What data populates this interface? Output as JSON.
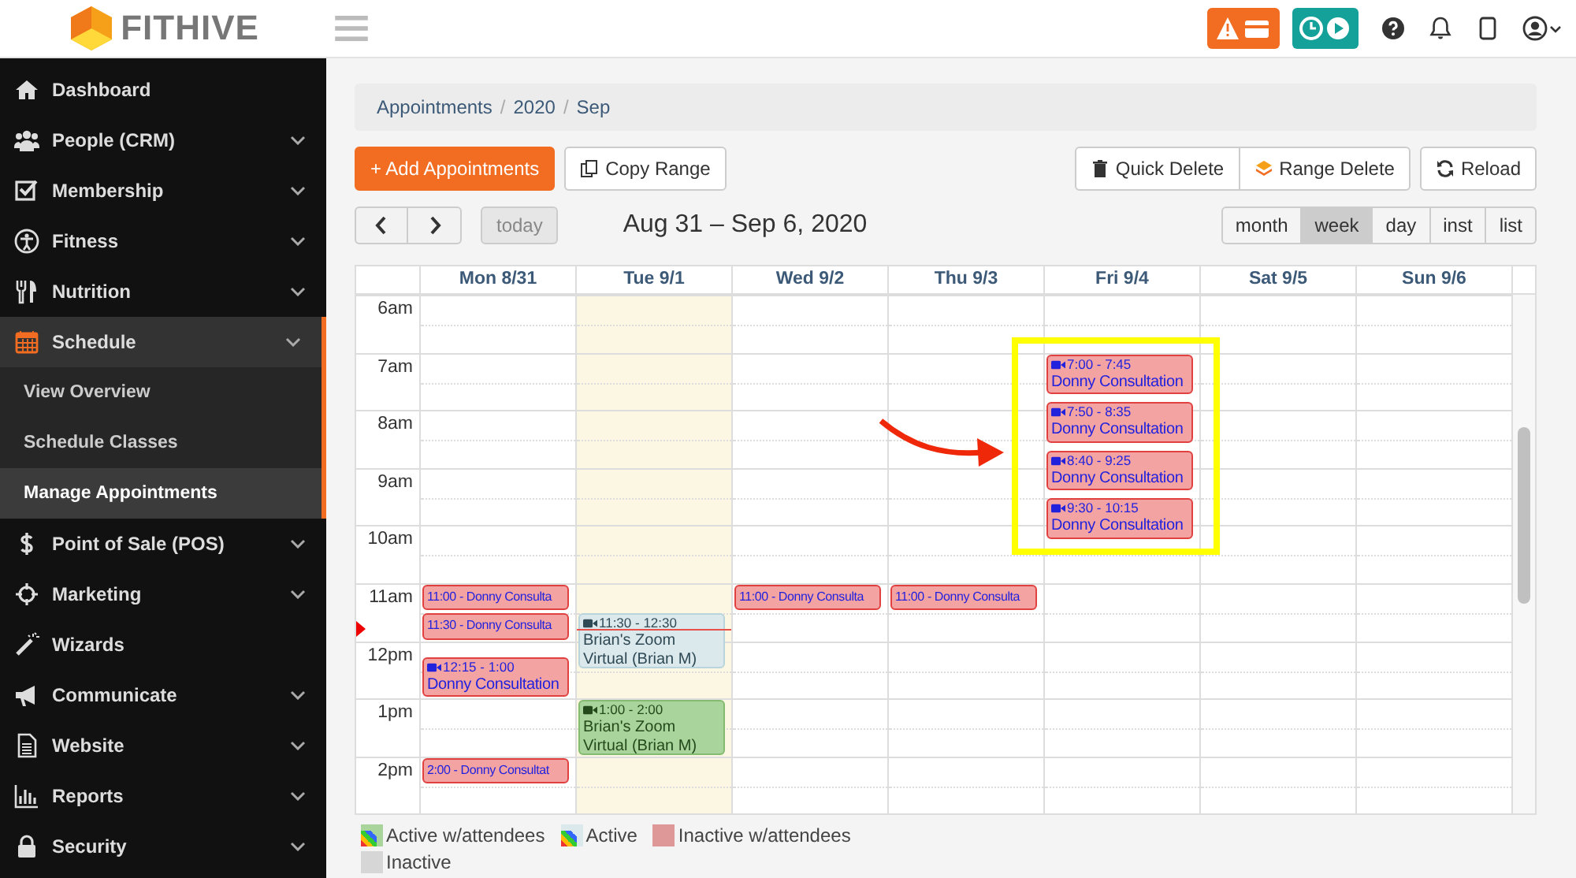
{
  "brand": {
    "name": "FITHIVE"
  },
  "sidebar": {
    "items": [
      {
        "label": "Dashboard",
        "has_submenu": false,
        "selected": false
      },
      {
        "label": "People (CRM)",
        "has_submenu": true,
        "expanded": false,
        "selected": false
      },
      {
        "label": "Membership",
        "has_submenu": true,
        "expanded": false,
        "selected": false
      },
      {
        "label": "Fitness",
        "has_submenu": true,
        "expanded": false,
        "selected": false
      },
      {
        "label": "Nutrition",
        "has_submenu": true,
        "expanded": false,
        "selected": false
      },
      {
        "label": "Schedule",
        "has_submenu": true,
        "expanded": true,
        "selected": true,
        "children": [
          {
            "label": "View Overview",
            "selected": false
          },
          {
            "label": "Schedule Classes",
            "selected": false
          },
          {
            "label": "Manage Appointments",
            "selected": true
          }
        ]
      },
      {
        "label": "Point of Sale (POS)",
        "has_submenu": true,
        "expanded": false,
        "selected": false
      },
      {
        "label": "Marketing",
        "has_submenu": true,
        "expanded": false,
        "selected": false
      },
      {
        "label": "Wizards",
        "has_submenu": false,
        "selected": false
      },
      {
        "label": "Communicate",
        "has_submenu": true,
        "expanded": false,
        "selected": false
      },
      {
        "label": "Website",
        "has_submenu": true,
        "expanded": false,
        "selected": false
      },
      {
        "label": "Reports",
        "has_submenu": true,
        "expanded": false,
        "selected": false
      },
      {
        "label": "Security",
        "has_submenu": true,
        "expanded": false,
        "selected": false
      }
    ]
  },
  "breadcrumb": {
    "items": [
      "Appointments",
      "2020",
      "Sep"
    ],
    "separator": "/"
  },
  "actions": {
    "left": [
      "+ Add Appointments",
      "Copy Range"
    ],
    "right": [
      "Quick Delete",
      "Range Delete",
      "Reload"
    ]
  },
  "nav": {
    "today": "today",
    "today_disabled": true,
    "title": "Aug 31 – Sep 6, 2020"
  },
  "views": [
    {
      "label": "month",
      "selected": false
    },
    {
      "label": "week",
      "selected": true
    },
    {
      "label": "day",
      "selected": false
    },
    {
      "label": "inst",
      "selected": false
    },
    {
      "label": "list",
      "selected": false
    }
  ],
  "calendar": {
    "hours": [
      "6am",
      "7am",
      "8am",
      "9am",
      "10am",
      "11am",
      "12pm",
      "1pm",
      "2pm"
    ],
    "now_marker": true,
    "days": [
      {
        "label": "Mon 8/31",
        "today": false,
        "events": [
          {
            "kind": "inactive_attendees",
            "label": "11:00 - Donny Consulta"
          },
          {
            "kind": "inactive_attendees",
            "label": "11:30 - Donny Consulta"
          },
          {
            "kind": "inactive_attendees",
            "video": true,
            "time": "12:15 - 1:00",
            "title": "Donny Consultation"
          },
          {
            "kind": "inactive_attendees",
            "label": "2:00 - Donny Consultat"
          }
        ]
      },
      {
        "label": "Tue 9/1",
        "today": true,
        "events": [
          {
            "kind": "active",
            "video": true,
            "time": "11:30 - 12:30",
            "title": "Brian's Zoom Virtual (Brian M)"
          },
          {
            "kind": "active_attendees",
            "video": true,
            "time": "1:00 - 2:00",
            "title": "Brian's Zoom Virtual (Brian M)"
          }
        ]
      },
      {
        "label": "Wed 9/2",
        "today": false,
        "events": [
          {
            "kind": "inactive_attendees",
            "label": "11:00 - Donny Consulta"
          }
        ]
      },
      {
        "label": "Thu 9/3",
        "today": false,
        "events": [
          {
            "kind": "inactive_attendees",
            "label": "11:00 - Donny Consulta"
          }
        ]
      },
      {
        "label": "Fri 9/4",
        "today": false,
        "events": [
          {
            "kind": "inactive_attendees",
            "video": true,
            "time": "7:00 - 7:45",
            "title": "Donny Consultation"
          },
          {
            "kind": "inactive_attendees",
            "video": true,
            "time": "7:50 - 8:35",
            "title": "Donny Consultation"
          },
          {
            "kind": "inactive_attendees",
            "video": true,
            "time": "8:40 - 9:25",
            "title": "Donny Consultation"
          },
          {
            "kind": "inactive_attendees",
            "video": true,
            "time": "9:30 - 10:15",
            "title": "Donny Consultation"
          }
        ]
      },
      {
        "label": "Sat 9/5",
        "today": false
      },
      {
        "label": "Sun 9/6",
        "today": false
      }
    ]
  },
  "annotations": {
    "highlight_box": true,
    "arrow": true
  },
  "legend": [
    {
      "kind": "active_attendees",
      "label": "Active w/attendees"
    },
    {
      "kind": "active",
      "label": "Active"
    },
    {
      "kind": "inactive_attendees",
      "label": "Inactive w/attendees"
    },
    {
      "kind": "inactive",
      "label": "Inactive"
    }
  ]
}
